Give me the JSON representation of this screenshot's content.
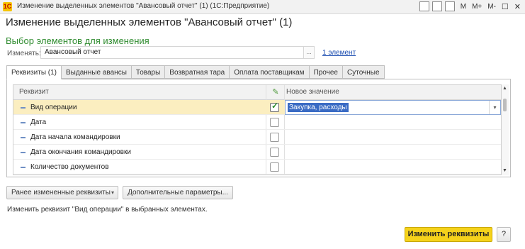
{
  "window": {
    "title": "Изменение выделенных элементов \"Авансовый отчет\" (1) (1С:Предприятие)",
    "app_icon": "1c-logo-icon",
    "toolbar_text": [
      "M",
      "M+",
      "M-"
    ]
  },
  "form": {
    "title": "Изменение выделенных элементов \"Авансовый отчет\" (1)",
    "section_title": "Выбор элементов для изменения",
    "change_label": "Изменять:",
    "change_value": "Авансовый отчет",
    "change_button": "...",
    "count_link": "1 элемент"
  },
  "tabs": [
    {
      "label": "Реквизиты (1)",
      "active": true
    },
    {
      "label": "Выданные авансы",
      "active": false
    },
    {
      "label": "Товары",
      "active": false
    },
    {
      "label": "Возвратная тара",
      "active": false
    },
    {
      "label": "Оплата поставщикам",
      "active": false
    },
    {
      "label": "Прочее",
      "active": false
    },
    {
      "label": "Суточные",
      "active": false
    }
  ],
  "table": {
    "columns": {
      "name": "Реквизит",
      "check_icon": "pencil-icon",
      "value": "Новое значение"
    },
    "rows": [
      {
        "name": "Вид операции",
        "checked": true,
        "value": "Закупка, расходы",
        "selected": true
      },
      {
        "name": "Дата",
        "checked": false,
        "value": ""
      },
      {
        "name": "Дата начала командировки",
        "checked": false,
        "value": ""
      },
      {
        "name": "Дата окончания командировки",
        "checked": false,
        "value": ""
      },
      {
        "name": "Количество документов",
        "checked": false,
        "value": ""
      }
    ]
  },
  "buttons": {
    "previous": "Ранее измененные реквизиты",
    "more": "Дополнительные параметры...",
    "apply": "Изменить реквизиты",
    "help": "?"
  },
  "hint": "Изменить реквизит \"Вид операции\" в выбранных элементах.",
  "colors": {
    "accent": "#f5d21b",
    "section": "#2e8b2e",
    "link": "#1a4cb0",
    "selected_row": "#fbeec0"
  }
}
